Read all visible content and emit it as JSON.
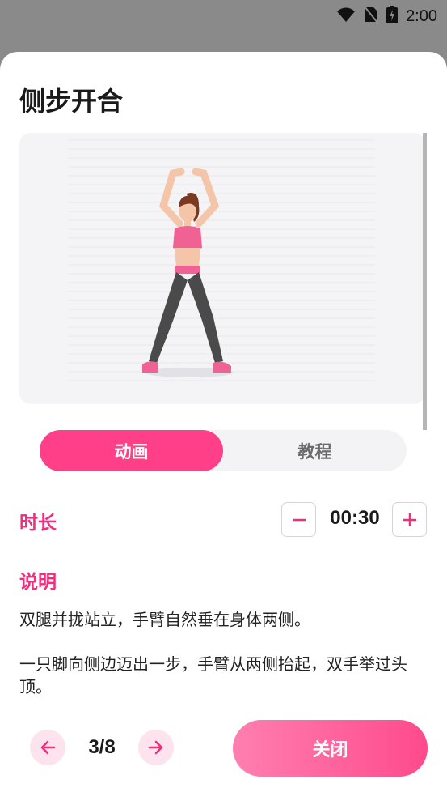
{
  "status_bar": {
    "time": "2:00"
  },
  "exercise": {
    "title": "侧步开合",
    "tabs": [
      {
        "label": "动画",
        "active": true
      },
      {
        "label": "教程",
        "active": false
      }
    ],
    "duration": {
      "label": "时长",
      "value": "00:30"
    },
    "description": {
      "label": "说明",
      "paragraphs": [
        "双腿并拢站立，手臂自然垂在身体两侧。",
        "一只脚向侧边迈出一步，手臂从两侧抬起，双手举过头顶。"
      ]
    }
  },
  "footer": {
    "page_indicator": "3/8",
    "close_label": "关闭"
  },
  "colors": {
    "accent": "#ee2f7b",
    "accent_fill": "#ff3f87",
    "nav_bg": "#fde3ee"
  }
}
